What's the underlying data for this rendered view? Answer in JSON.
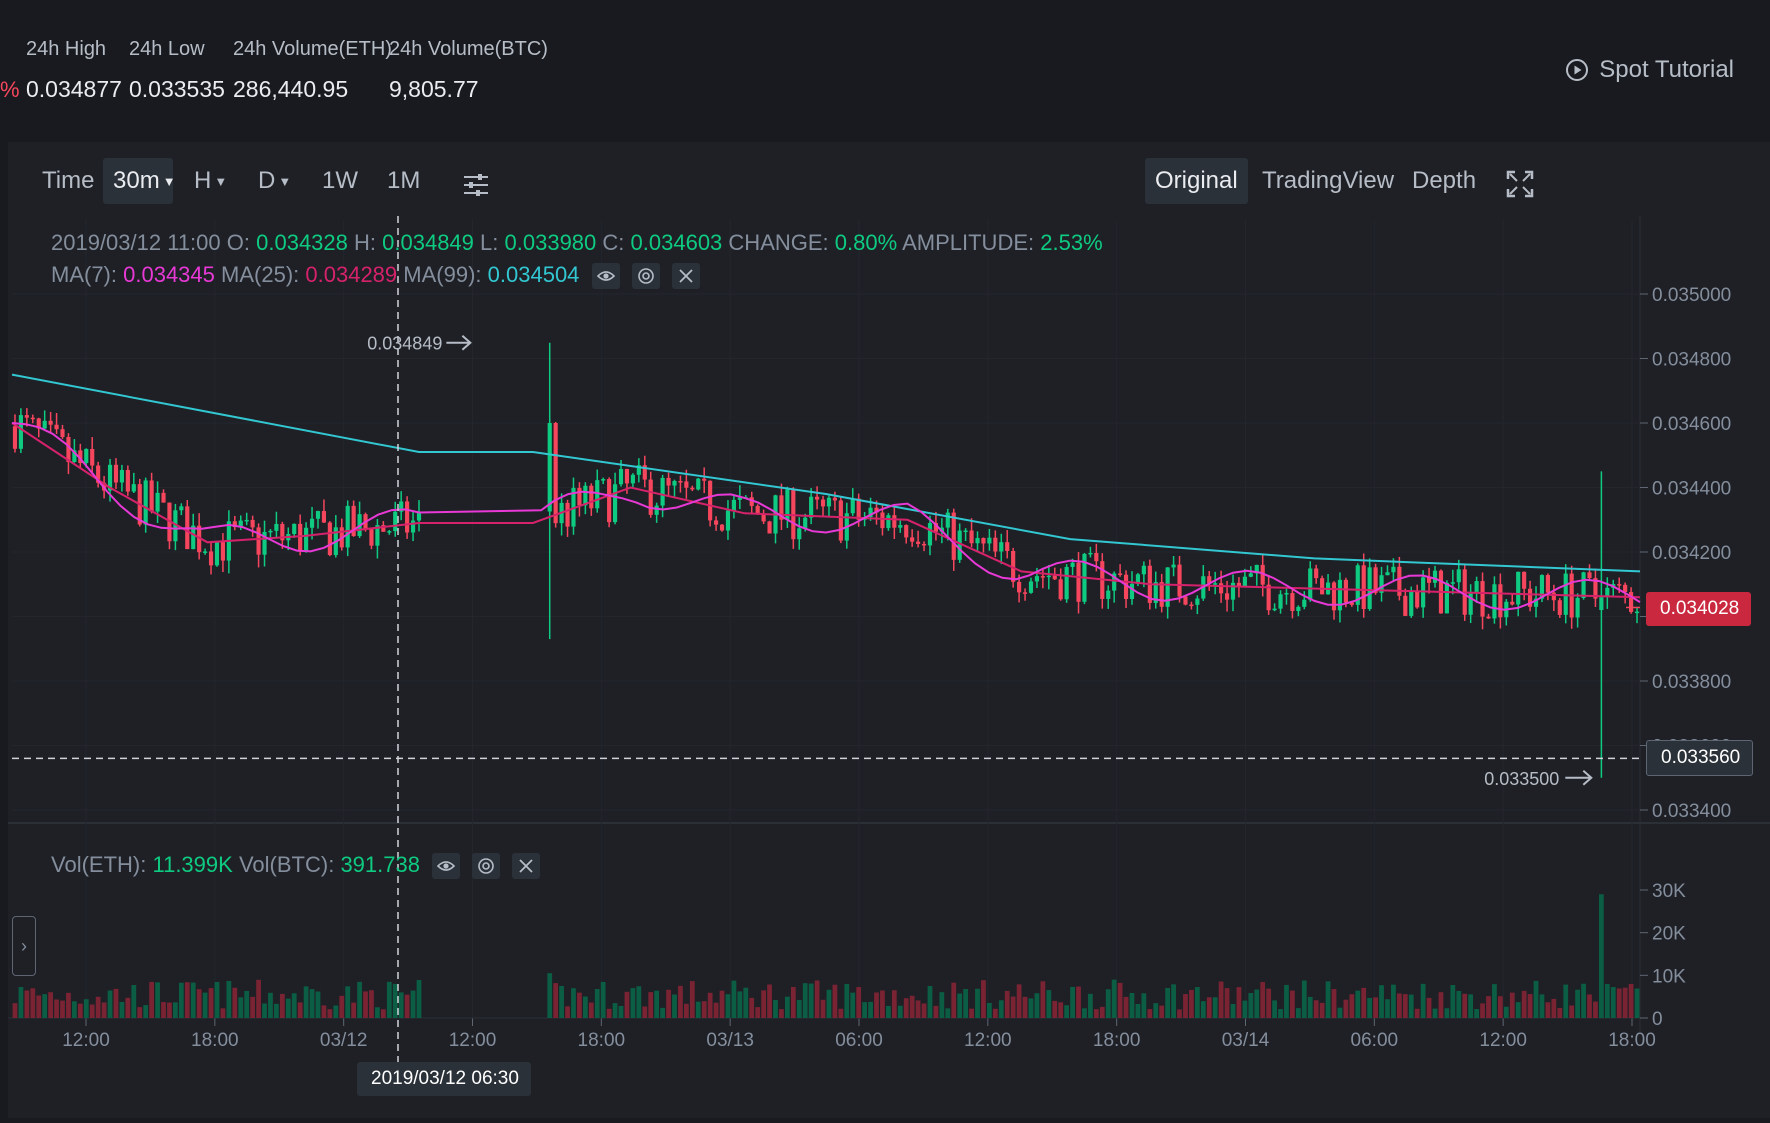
{
  "ticker": {
    "change_fragment": "%",
    "stats": [
      {
        "label": "24h High",
        "value": "0.034877"
      },
      {
        "label": "24h Low",
        "value": "0.033535"
      },
      {
        "label": "24h Volume(ETH)",
        "value": "286,440.95"
      },
      {
        "label": "24h Volume(BTC)",
        "value": "9,805.77"
      }
    ],
    "tutorial_label": "Spot Tutorial"
  },
  "toolbar": {
    "intervals": [
      "Time",
      "30m",
      "H",
      "D",
      "1W",
      "1M"
    ],
    "active_interval": "30m",
    "views": [
      "Original",
      "TradingView",
      "Depth"
    ],
    "active_view": "Original"
  },
  "legend": {
    "datetime": "2019/03/12 11:00",
    "open_label": "O:",
    "open": "0.034328",
    "high_label": "H:",
    "high": "0.034849",
    "low_label": "L:",
    "low": "0.033980",
    "close_label": "C:",
    "close": "0.034603",
    "change_label": "CHANGE:",
    "change": "0.80%",
    "amplitude_label": "AMPLITUDE:",
    "amplitude": "2.53%",
    "ma7_label": "MA(7):",
    "ma7": "0.034345",
    "ma25_label": "MA(25):",
    "ma25": "0.034289",
    "ma99_label": "MA(99):",
    "ma99": "0.034504",
    "vol_eth_label": "Vol(ETH):",
    "vol_eth": "11.399K",
    "vol_btc_label": "Vol(BTC):",
    "vol_btc": "391.738"
  },
  "markers": {
    "high_marker": "0.034849",
    "low_marker": "0.033500",
    "last_price": "0.034028",
    "crosshair_price": "0.033560",
    "crosshair_time": "2019/03/12 06:30"
  },
  "colors": {
    "up": "#0ecb81",
    "down": "#f6465d",
    "ma7": "#e839d6",
    "ma25": "#d6226b",
    "ma99": "#32c7d1"
  },
  "chart_data": {
    "type": "candlestick",
    "price_axis": [
      "0.035000",
      "0.034800",
      "0.034600",
      "0.034400",
      "0.034200",
      "0.034000",
      "0.033800",
      "0.033600",
      "0.033400"
    ],
    "volume_axis": [
      "30K",
      "20K",
      "10K",
      "0"
    ],
    "ylim": [
      0.0334,
      0.035
    ],
    "volume_ylim": [
      0,
      30000
    ],
    "time_axis": [
      "12:00",
      "18:00",
      "03/12",
      "12:00",
      "18:00",
      "03/13",
      "06:00",
      "12:00",
      "18:00",
      "03/14",
      "06:00",
      "12:00",
      "18:00"
    ],
    "candle_count": 274,
    "candle_interval_minutes": 30,
    "ma_series": [
      {
        "name": "MA(99)",
        "points": [
          [
            0,
            0.03475
          ],
          [
            0.25,
            0.03451
          ],
          [
            0.32,
            0.03451
          ],
          [
            0.5,
            0.03438
          ],
          [
            0.65,
            0.03424
          ],
          [
            0.8,
            0.03418
          ],
          [
            1,
            0.03414
          ]
        ]
      },
      {
        "name": "MA(25)",
        "points": [
          [
            0,
            0.0346
          ],
          [
            0.06,
            0.0344
          ],
          [
            0.12,
            0.03423
          ],
          [
            0.18,
            0.03425
          ],
          [
            0.25,
            0.03429
          ],
          [
            0.32,
            0.03429
          ],
          [
            0.38,
            0.0344
          ],
          [
            0.45,
            0.03432
          ],
          [
            0.55,
            0.0343
          ],
          [
            0.62,
            0.03414
          ],
          [
            0.7,
            0.0341
          ],
          [
            0.85,
            0.03408
          ],
          [
            1,
            0.03406
          ]
        ]
      }
    ],
    "notable": {
      "spike_up_high": 0.034849,
      "spike_down_low": 0.0335,
      "last_price": 0.034028,
      "max_volume": 29000
    }
  }
}
